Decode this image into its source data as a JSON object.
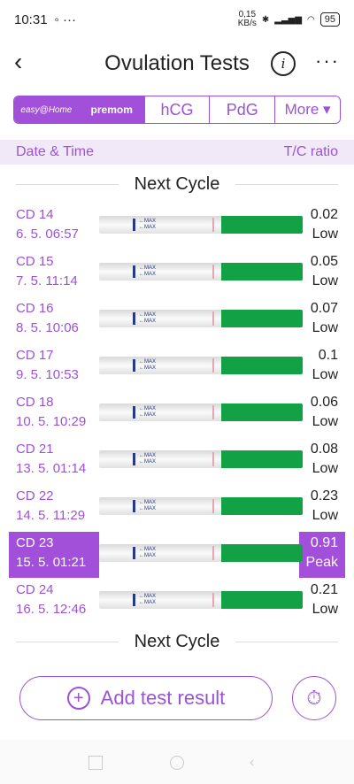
{
  "status": {
    "time": "10:31",
    "speed_top": "0,15",
    "speed_unit": "KB/s",
    "battery": "95"
  },
  "header": {
    "title": "Ovulation Tests"
  },
  "tabs": [
    {
      "label": "easy@Home"
    },
    {
      "label": "premom"
    },
    {
      "label": "hCG"
    },
    {
      "label": "PdG"
    },
    {
      "label": "More ▾"
    }
  ],
  "list_header": {
    "left": "Date & Time",
    "right": "T/C ratio"
  },
  "cycle_label": "Next Cycle",
  "rows": [
    {
      "cd": "CD 14",
      "date": "6. 5. 06:57",
      "ratio": "0.02",
      "level": "Low"
    },
    {
      "cd": "CD 15",
      "date": "7. 5. 11:14",
      "ratio": "0.05",
      "level": "Low"
    },
    {
      "cd": "CD 16",
      "date": "8. 5. 10:06",
      "ratio": "0.07",
      "level": "Low"
    },
    {
      "cd": "CD 17",
      "date": "9. 5. 10:53",
      "ratio": "0.1",
      "level": "Low"
    },
    {
      "cd": "CD 18",
      "date": "10. 5. 10:29",
      "ratio": "0.06",
      "level": "Low"
    },
    {
      "cd": "CD 21",
      "date": "13. 5. 01:14",
      "ratio": "0.08",
      "level": "Low"
    },
    {
      "cd": "CD 22",
      "date": "14. 5. 11:29",
      "ratio": "0.23",
      "level": "Low"
    },
    {
      "cd": "CD 23",
      "date": "15. 5. 01:21",
      "ratio": "0.91",
      "level": "Peak"
    },
    {
      "cd": "CD 24",
      "date": "16. 5. 12:46",
      "ratio": "0.21",
      "level": "Low"
    }
  ],
  "actions": {
    "add": "Add test result"
  },
  "colors": {
    "accent": "#a24fd9",
    "strip_green": "#12a145"
  }
}
